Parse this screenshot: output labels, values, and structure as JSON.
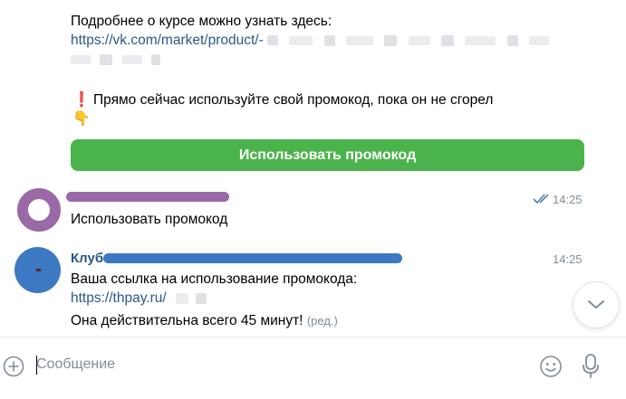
{
  "messages": {
    "bot_top": {
      "line1": "Подробнее о курсе можно узнать здесь:",
      "link_prefix": "https://vk.com/market/product/-",
      "promo_emoji_top": "❗",
      "promo_emoji_bottom": "👇",
      "promo_text": "Прямо сейчас используйте свой промокод, пока он не сгорел",
      "button_label": "Использовать промокод"
    },
    "user": {
      "time": "14:25",
      "text": "Использовать промокод"
    },
    "club": {
      "name_start": "Клуб",
      "time": "14:25",
      "line1": "Ваша ссылка на использование промокода:",
      "link": "https://thpay.ru/",
      "line3": "Она действительна всего 45 минут!",
      "edited": "(ред.)"
    }
  },
  "composer": {
    "placeholder": "Сообщение"
  },
  "colors": {
    "button": "#4bb34b",
    "link": "#2a5885",
    "user_avatar": "#9a6aa6",
    "club_avatar": "#3d78c2",
    "meta": "#818c99"
  },
  "icons": {
    "attach": "add-circle-icon",
    "emoji": "smile-icon",
    "voice": "microphone-icon",
    "scroll": "chevron-down-icon",
    "read": "double-check-icon"
  }
}
